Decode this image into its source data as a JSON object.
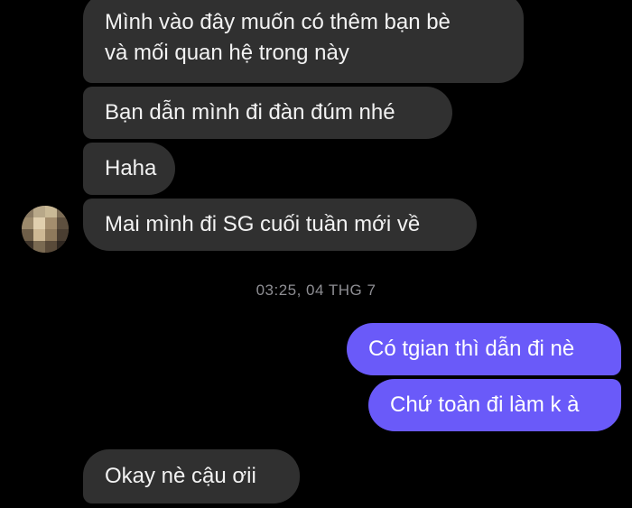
{
  "conversation": {
    "incoming": [
      {
        "lines": [
          "Mình vào đây muốn có thêm bạn bè",
          "và mối quan hệ trong này"
        ]
      },
      {
        "text": "Bạn dẫn mình đi đàn đúm nhé"
      },
      {
        "text": "Haha"
      },
      {
        "text": "Mai mình đi SG cuối tuần mới về"
      }
    ],
    "timestamp": "03:25, 04 THG 7",
    "outgoing": [
      {
        "text": "Có tgian thì dẫn đi nè"
      },
      {
        "text": "Chứ toàn đi làm k à"
      }
    ],
    "last_incoming": {
      "text": "Okay nè cậu ơii"
    }
  },
  "colors": {
    "background": "#000000",
    "incoming_bubble": "#303030",
    "outgoing_bubble": "#6a5af9",
    "timestamp_text": "#8e8e93"
  },
  "avatar": {
    "icon": "pixelated-avatar-icon"
  }
}
